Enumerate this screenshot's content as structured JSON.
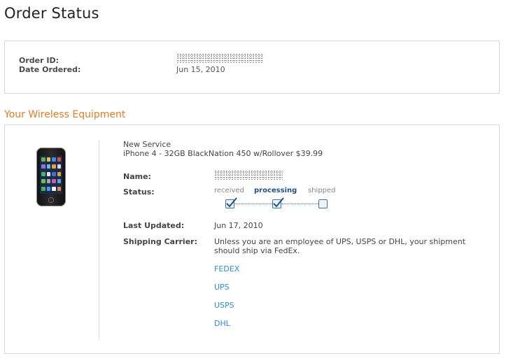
{
  "page": {
    "title": "Order Status"
  },
  "order": {
    "id_label": "Order ID:",
    "id_value": "",
    "date_label": "Date Ordered:",
    "date_value": "Jun 15, 2010"
  },
  "equipment": {
    "heading": "Your Wireless Equipment",
    "service_type": "New Service",
    "product": "iPhone 4 - 32GB BlackNation 450 w/Rollover $39.99",
    "name_label": "Name:",
    "name_value": "",
    "status_label": "Status:",
    "status_steps": [
      {
        "label": "received",
        "checked": true,
        "active": false
      },
      {
        "label": "processing",
        "checked": true,
        "active": true
      },
      {
        "label": "shipped",
        "checked": false,
        "active": false
      }
    ],
    "last_updated_label": "Last Updated:",
    "last_updated_value": "Jun 17, 2010",
    "carrier_label": "Shipping Carrier:",
    "carrier_note": "Unless you are an employee of UPS, USPS or DHL, your shipment should ship via FedEx.",
    "carriers": [
      "FEDEX",
      "UPS",
      "USPS",
      "DHL"
    ]
  },
  "colors": {
    "accent_orange": "#e87b1e",
    "link_blue": "#2b8fd6",
    "status_blue": "#1f4f8f",
    "border_gray": "#d8d8d8"
  },
  "icons": {
    "phone": "iphone-image",
    "checkmark": "checkmark-icon"
  }
}
